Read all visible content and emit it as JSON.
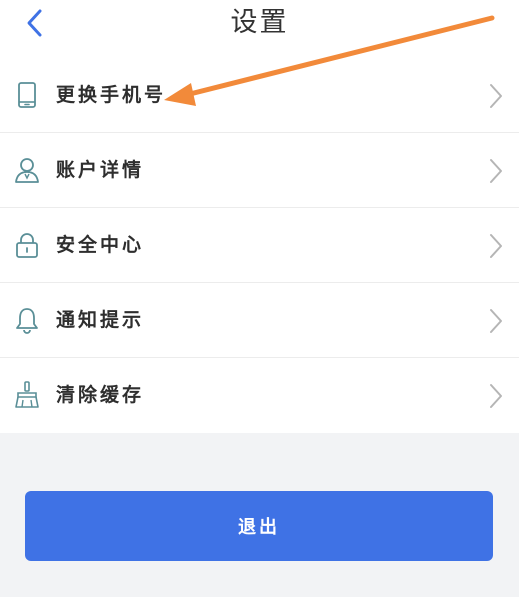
{
  "header": {
    "title": "设置",
    "back_icon": "chevron-left-icon"
  },
  "settings": {
    "items": [
      {
        "label": "更换手机号",
        "icon": "phone-icon"
      },
      {
        "label": "账户详情",
        "icon": "user-icon"
      },
      {
        "label": "安全中心",
        "icon": "lock-icon"
      },
      {
        "label": "通知提示",
        "icon": "bell-icon"
      },
      {
        "label": "清除缓存",
        "icon": "broom-icon"
      }
    ],
    "chevron_icon": "chevron-right-icon"
  },
  "logout": {
    "label": "退出"
  },
  "annotation": {
    "icon": "arrow-icon",
    "color": "#f28a3a"
  },
  "colors": {
    "accent": "#3f72e5",
    "icon": "#5a8f97",
    "background": "#f2f3f5"
  }
}
